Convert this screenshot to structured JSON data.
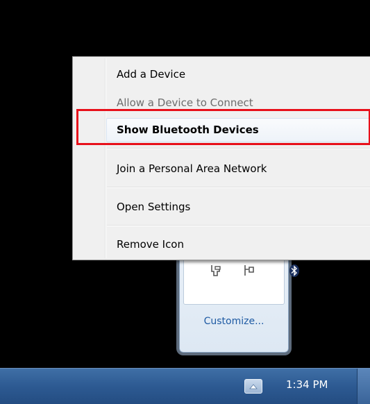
{
  "context_menu": {
    "items": [
      {
        "label": "Add a Device",
        "enabled": true
      },
      {
        "label": "Allow a Device to Connect",
        "enabled": false
      },
      {
        "label": "Show Bluetooth Devices",
        "enabled": true,
        "default": true
      },
      {
        "label": "Join a Personal Area Network",
        "enabled": true
      },
      {
        "label": "Open Settings",
        "enabled": true
      },
      {
        "label": "Remove Icon",
        "enabled": true
      }
    ]
  },
  "tray_popup": {
    "icons": [
      "usb-device-icon",
      "network-plug-icon",
      "bluetooth-icon"
    ],
    "customize_label": "Customize..."
  },
  "taskbar": {
    "clock": "1:34 PM",
    "show_hidden_icons": "chevron-up-icon"
  },
  "colors": {
    "highlight_box": "#e8101b",
    "taskbar": "#2d5a92",
    "link": "#1e5aa3"
  }
}
